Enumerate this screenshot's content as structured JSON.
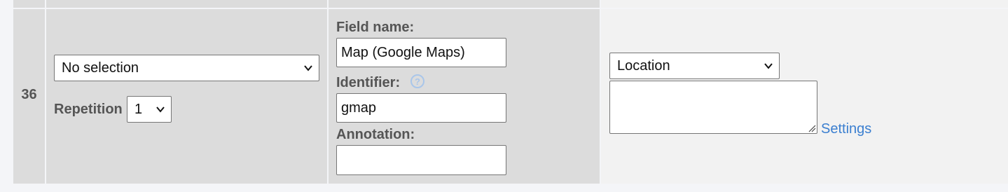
{
  "row": {
    "number": "36",
    "type_select": {
      "selected": "No selection"
    },
    "repetition": {
      "label": "Repetition",
      "selected": "1"
    },
    "field_name": {
      "label": "Field name:",
      "value": "Map (Google Maps)"
    },
    "identifier": {
      "label": "Identifier:",
      "value": "gmap",
      "help_glyph": "?"
    },
    "annotation": {
      "label": "Annotation:",
      "value": ""
    },
    "options": {
      "select": {
        "selected": "Location"
      },
      "textarea_value": "",
      "settings_link": "Settings"
    }
  },
  "icons": {
    "dropdown": "chevron-down-icon",
    "help": "question-circle-icon",
    "resize": "resize-grip-icon"
  },
  "colors": {
    "cell_bg": "#dcdcdc",
    "options_bg": "#f2f2f2",
    "page_bg": "#f4f5f8",
    "label_text": "#555555",
    "link": "#3b7fd0",
    "help_icon": "#a9c6ea"
  }
}
